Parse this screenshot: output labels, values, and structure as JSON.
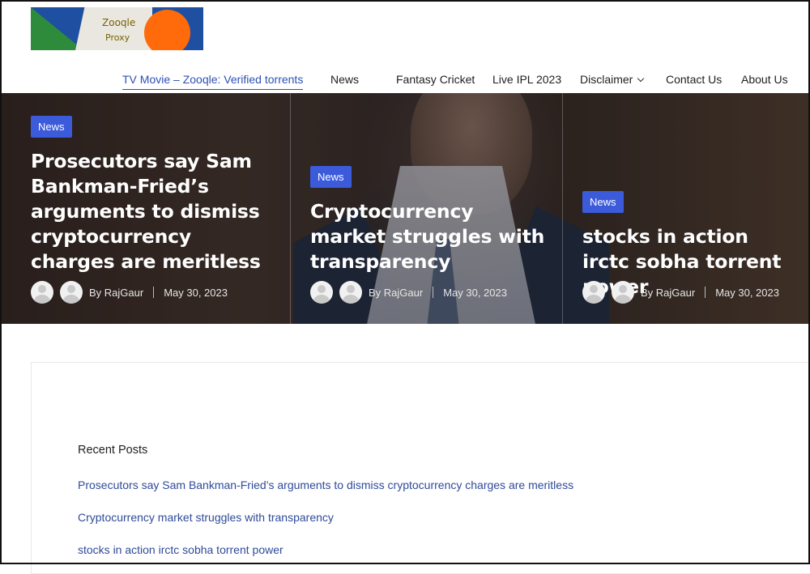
{
  "logo": {
    "line1": "Zooqle",
    "line2": "Proxy"
  },
  "nav": {
    "items": [
      {
        "label": "TV Movie – Zooqle: Verified torrents",
        "active": true
      },
      {
        "label": "News"
      },
      {
        "label": "Fantasy Cricket"
      },
      {
        "label": "Live IPL 2023"
      },
      {
        "label": "Disclaimer",
        "has_dropdown": true
      },
      {
        "label": "Contact Us"
      },
      {
        "label": "About Us"
      }
    ]
  },
  "hero": {
    "cards": [
      {
        "category": "News",
        "title": "Prosecutors say Sam Bankman-Fried’s arguments to dismiss cryptocurrency charges are meritless",
        "author": "By RajGaur",
        "date": "May 30, 2023"
      },
      {
        "category": "News",
        "title": "Cryptocurrency market struggles with transparency",
        "author": "By RajGaur",
        "date": "May 30, 2023"
      },
      {
        "category": "News",
        "title": "stocks in action irctc sobha torrent power",
        "author": "By RajGaur",
        "date": "May 30, 2023"
      }
    ]
  },
  "recent_posts": {
    "heading": "Recent Posts",
    "items": [
      "Prosecutors say Sam Bankman-Fried’s arguments to dismiss cryptocurrency charges are meritless",
      "Cryptocurrency market struggles with transparency",
      "stocks in action irctc sobha torrent power"
    ]
  },
  "colors": {
    "accent": "#3b5bdb",
    "link": "#2f4a9a",
    "nav_active": "#2f4fb4"
  }
}
